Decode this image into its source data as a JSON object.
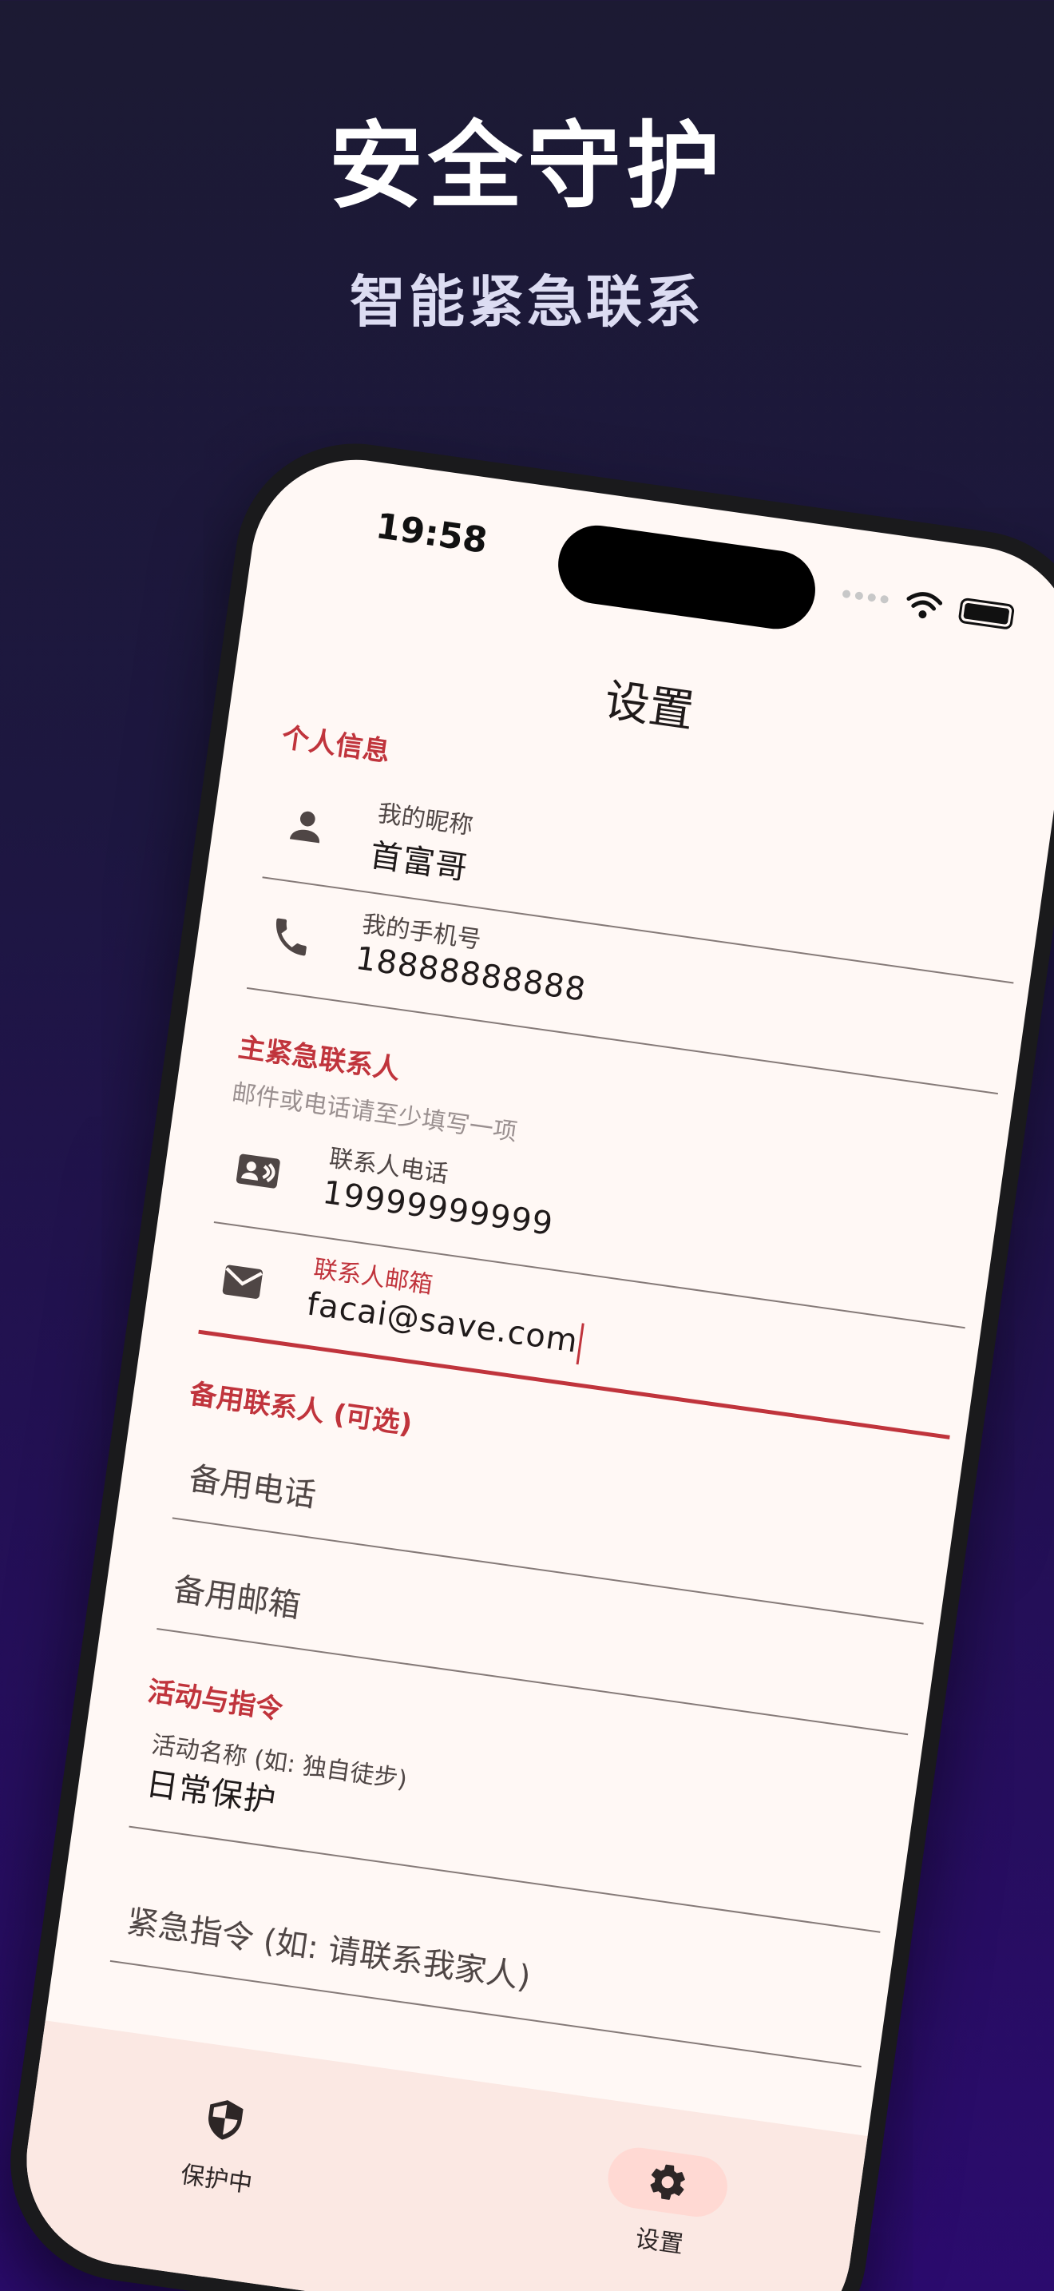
{
  "hero": {
    "title": "安全守护",
    "subtitle": "智能紧急联系"
  },
  "status_bar": {
    "time": "19:58",
    "icons": [
      "signal-icon",
      "wifi-icon",
      "battery-icon"
    ]
  },
  "app_bar": {
    "title": "设置"
  },
  "sections": {
    "personal": {
      "header": "个人信息",
      "nickname": {
        "label": "我的昵称",
        "value": "首富哥",
        "icon": "person-icon"
      },
      "phone": {
        "label": "我的手机号",
        "value": "18888888888",
        "icon": "phone-icon"
      }
    },
    "primary_contact": {
      "header": "主紧急联系人",
      "hint": "邮件或电话请至少填写一项",
      "phone": {
        "label": "联系人电话",
        "value": "19999999999",
        "icon": "contact-card-icon"
      },
      "email": {
        "label": "联系人邮箱",
        "value": "facai@save.com",
        "icon": "mail-icon"
      }
    },
    "backup_contact": {
      "header": "备用联系人 (可选)",
      "phone_placeholder": "备用电话",
      "email_placeholder": "备用邮箱"
    },
    "activity": {
      "header": "活动与指令",
      "activity_name": {
        "label": "活动名称 (如: 独自徒步)",
        "value": "日常保护"
      },
      "instruction_placeholder": "紧急指令 (如: 请联系我家人)"
    }
  },
  "bottom_nav": {
    "items": [
      {
        "label": "保护中",
        "icon": "shield-icon",
        "active": false
      },
      {
        "label": "设置",
        "icon": "gear-icon",
        "active": true
      }
    ]
  },
  "colors": {
    "accent": "#c0343c",
    "surface": "#fff8f5",
    "nav_background": "#fbe8e3",
    "active_pill": "#ffd9d3"
  }
}
